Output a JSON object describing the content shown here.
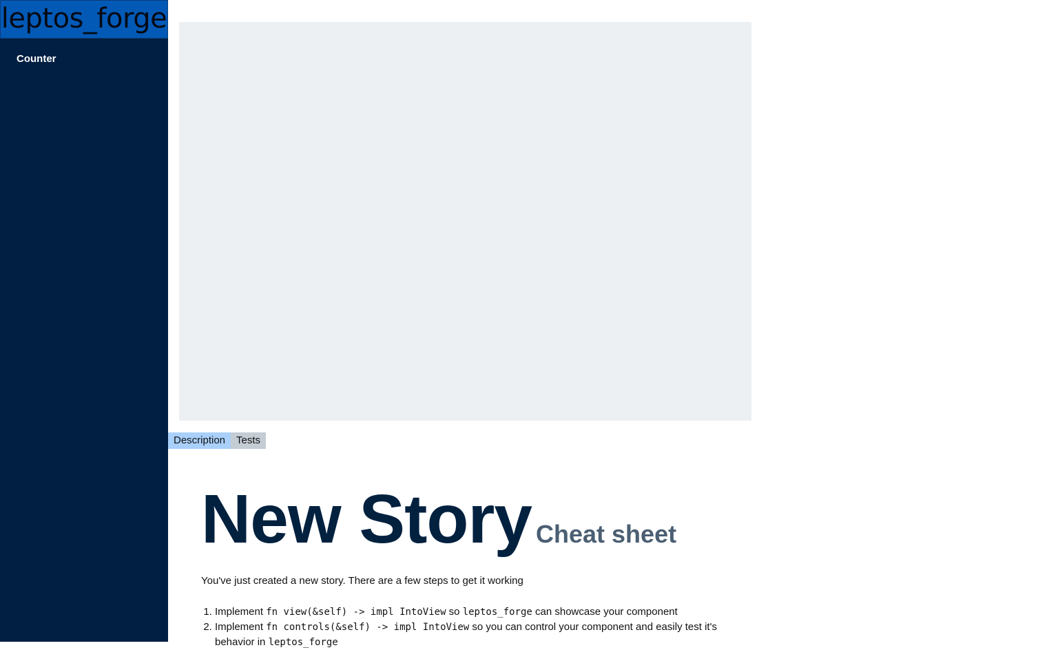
{
  "sidebar": {
    "logo": "leptos_forge",
    "items": [
      {
        "label": "Counter"
      }
    ]
  },
  "tabs": [
    {
      "label": "Description",
      "active": true
    },
    {
      "label": "Tests",
      "active": false
    }
  ],
  "doc": {
    "title": "New Story",
    "subtitle": "Cheat sheet",
    "intro": "You've just created a new story. There are a few steps to get it working",
    "steps": [
      {
        "t1": "Implement ",
        "code1": "fn view(&self) -> impl IntoView",
        "t2": " so ",
        "code2": "leptos_forge",
        "t3": " can showcase your component"
      },
      {
        "t1": "Implement ",
        "code1": "fn controls(&self) -> impl IntoView",
        "t2": " so you can control your component and easily test it's behavior in ",
        "code2": "leptos_forge",
        "t3": ""
      }
    ]
  },
  "colors": {
    "sidebar_bg": "#001f42",
    "logo_bg": "#0359b6",
    "preview_bg": "#ecf0f3",
    "tab_active": "#a9d0fa",
    "tab_inactive": "#c4ccd4",
    "title": "#02213f",
    "subtitle": "#4b5f73"
  }
}
